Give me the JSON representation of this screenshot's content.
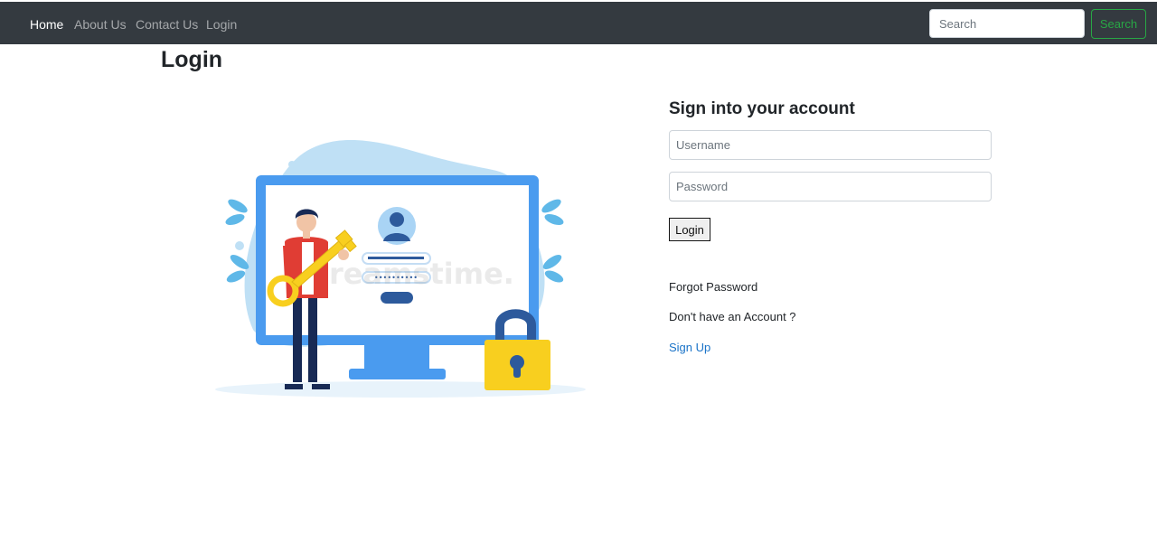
{
  "nav": {
    "items": [
      {
        "label": "Home",
        "active": true
      },
      {
        "label": "About Us",
        "active": false
      },
      {
        "label": "Contact Us",
        "active": false
      },
      {
        "label": "Login",
        "active": false
      }
    ],
    "search": {
      "placeholder": "Search",
      "button_label": "Search"
    }
  },
  "page": {
    "title": "Login"
  },
  "illustration": {
    "icon": "computer-login-key-lock-illustration",
    "watermark": "dreamstime."
  },
  "form": {
    "heading": "Sign into your account",
    "username_placeholder": "Username",
    "password_placeholder": "Password",
    "login_button": "Login",
    "forgot_password": "Forgot Password",
    "no_account_text": "Don't have an Account ?",
    "signup_link": "Sign Up"
  },
  "colors": {
    "navbar": "#343a40",
    "success": "#28a745",
    "link": "#1a73c8",
    "illustration_blue": "#4a9bef",
    "illustration_yellow": "#f8cf1f"
  }
}
